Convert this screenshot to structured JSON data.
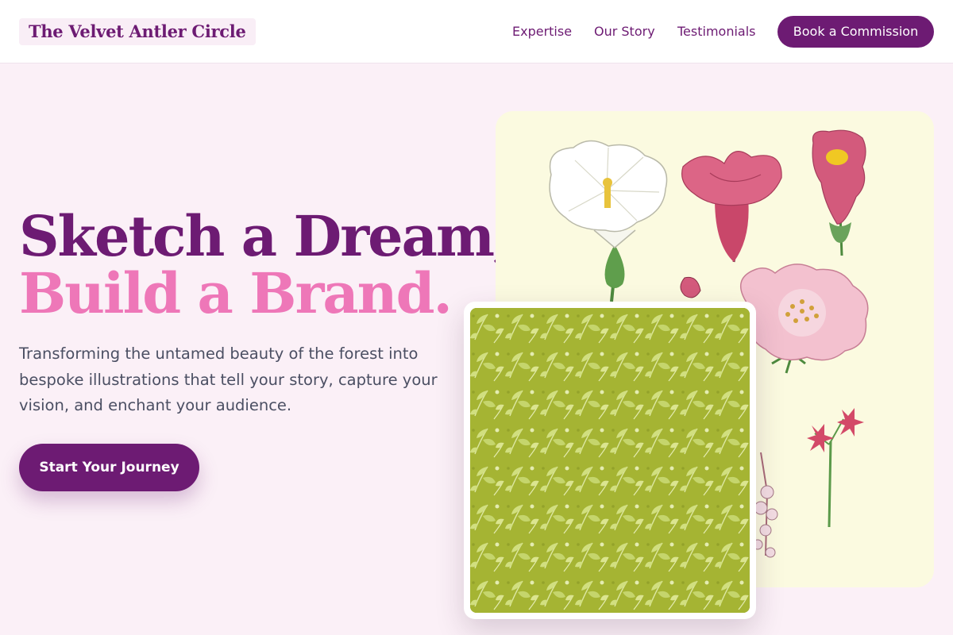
{
  "brand": {
    "name": "The Velvet Antler Circle"
  },
  "nav": {
    "links": [
      "Expertise",
      "Our Story",
      "Testimonials"
    ],
    "cta": "Book a Commission"
  },
  "hero": {
    "title_line1": "Sketch a Dream,",
    "title_line2": "Build a Brand.",
    "description": "Transforming the untamed beauty of the forest into bespoke illustrations that tell your story, capture your vision, and enchant your audience.",
    "cta": "Start Your Journey"
  },
  "colors": {
    "primary": "#6d1b73",
    "accent_pink": "#ee77b8",
    "background": "#fbf0f7",
    "text_body": "#4b4f63",
    "pattern_green": "#a2b02f",
    "botanical_paper": "#fbfae0"
  }
}
